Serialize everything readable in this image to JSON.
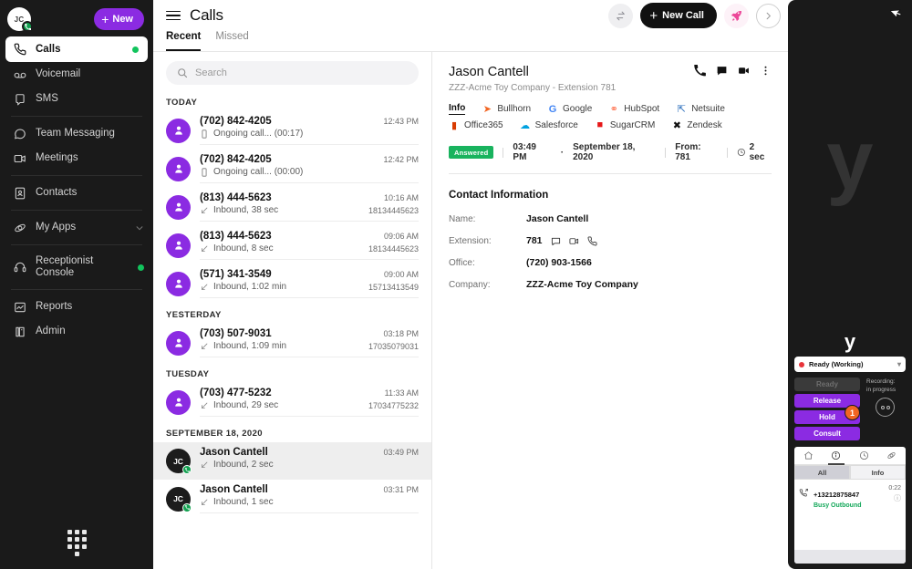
{
  "nav": {
    "avatar_initials": "JC",
    "new_button": "New",
    "items": [
      {
        "label": "Calls",
        "icon": "phone-icon",
        "active": true,
        "dot": true
      },
      {
        "label": "Voicemail",
        "icon": "voicemail-icon",
        "active": false,
        "dot": false
      },
      {
        "label": "SMS",
        "icon": "sms-icon",
        "active": false,
        "dot": false
      },
      {
        "label": "Team Messaging",
        "icon": "chat-icon",
        "active": false,
        "dot": false
      },
      {
        "label": "Meetings",
        "icon": "video-icon",
        "active": false,
        "dot": false
      },
      {
        "label": "Contacts",
        "icon": "contacts-icon",
        "active": false,
        "dot": false
      },
      {
        "label": "My Apps",
        "icon": "apps-icon",
        "active": false,
        "dot": false
      },
      {
        "label": "Receptionist Console",
        "icon": "headset-icon",
        "active": false,
        "dot": true
      },
      {
        "label": "Reports",
        "icon": "reports-icon",
        "active": false,
        "dot": false
      },
      {
        "label": "Admin",
        "icon": "admin-icon",
        "active": false,
        "dot": false
      }
    ]
  },
  "header": {
    "title": "Calls",
    "new_call_button": "New Call",
    "tabs": [
      {
        "label": "Recent",
        "active": true
      },
      {
        "label": "Missed",
        "active": false
      }
    ]
  },
  "search": {
    "placeholder": "Search",
    "value": ""
  },
  "calls": {
    "groups": [
      {
        "label": "TODAY",
        "rows": [
          {
            "avatar": "person",
            "initials": "",
            "name": "(702) 842-4205",
            "time": "12:43 PM",
            "detail": "Ongoing call... (00:17)",
            "number": "",
            "direction": "device",
            "selected": false
          },
          {
            "avatar": "person",
            "initials": "",
            "name": "(702) 842-4205",
            "time": "12:42 PM",
            "detail": "Ongoing call... (00:00)",
            "number": "",
            "direction": "device",
            "selected": false
          },
          {
            "avatar": "person",
            "initials": "",
            "name": "(813) 444-5623",
            "time": "10:16 AM",
            "detail": "Inbound, 38 sec",
            "number": "18134445623",
            "direction": "inbound",
            "selected": false
          },
          {
            "avatar": "person",
            "initials": "",
            "name": "(813) 444-5623",
            "time": "09:06 AM",
            "detail": "Inbound, 8 sec",
            "number": "18134445623",
            "direction": "inbound",
            "selected": false
          },
          {
            "avatar": "person",
            "initials": "",
            "name": "(571) 341-3549",
            "time": "09:00 AM",
            "detail": "Inbound, 1:02 min",
            "number": "15713413549",
            "direction": "inbound",
            "selected": false
          }
        ]
      },
      {
        "label": "YESTERDAY",
        "rows": [
          {
            "avatar": "person",
            "initials": "",
            "name": "(703) 507-9031",
            "time": "03:18 PM",
            "detail": "Inbound, 1:09 min",
            "number": "17035079031",
            "direction": "inbound",
            "selected": false
          }
        ]
      },
      {
        "label": "TUESDAY",
        "rows": [
          {
            "avatar": "person",
            "initials": "",
            "name": "(703) 477-5232",
            "time": "11:33 AM",
            "detail": "Inbound, 29 sec",
            "number": "17034775232",
            "direction": "inbound",
            "selected": false
          }
        ]
      },
      {
        "label": "SEPTEMBER 18, 2020",
        "rows": [
          {
            "avatar": "initials",
            "initials": "JC",
            "name": "Jason Cantell",
            "time": "03:49 PM",
            "detail": "Inbound, 2 sec",
            "number": "",
            "direction": "inbound",
            "selected": true
          },
          {
            "avatar": "initials",
            "initials": "JC",
            "name": "Jason Cantell",
            "time": "03:31 PM",
            "detail": "Inbound, 1 sec",
            "number": "",
            "direction": "inbound",
            "selected": false
          }
        ]
      }
    ]
  },
  "detail": {
    "name": "Jason Cantell",
    "subtitle": "ZZZ-Acme Toy Company - Extension 781",
    "crm_tabs": [
      {
        "label": "Info",
        "glyph": "",
        "active": true
      },
      {
        "label": "Bullhorn",
        "glyph": "📣",
        "active": false
      },
      {
        "label": "Google",
        "glyph": "G",
        "active": false
      },
      {
        "label": "HubSpot",
        "glyph": "Ⓗ",
        "active": false
      },
      {
        "label": "Netsuite",
        "glyph": "↱",
        "active": false
      },
      {
        "label": "Office365",
        "glyph": "◧",
        "active": false
      },
      {
        "label": "Salesforce",
        "glyph": "☁",
        "active": false
      },
      {
        "label": "SugarCRM",
        "glyph": "▮",
        "active": false
      },
      {
        "label": "Zendesk",
        "glyph": "✕",
        "active": false
      }
    ],
    "status_badge": "Answered",
    "call_time": "03:49 PM",
    "call_date": "September 18, 2020",
    "call_from": "From: 781",
    "call_duration": "2 sec",
    "section_title": "Contact Information",
    "fields": [
      {
        "label": "Name:",
        "value": "Jason Cantell",
        "has_icons": false
      },
      {
        "label": "Extension:",
        "value": "781",
        "has_icons": true
      },
      {
        "label": "Office:",
        "value": "(720) 903-1566",
        "has_icons": false
      },
      {
        "label": "Company:",
        "value": "ZZZ-Acme Toy Company",
        "has_icons": false
      }
    ]
  },
  "phone_widget": {
    "logo": "у",
    "status": "Ready (Working)",
    "status_color": "#e8343a",
    "buttons": [
      {
        "label": "Ready",
        "state": "disabled"
      },
      {
        "label": "Release",
        "state": "active"
      },
      {
        "label": "Hold",
        "state": "active"
      },
      {
        "label": "Consult",
        "state": "active"
      }
    ],
    "recording_label_1": "Recording:",
    "recording_label_2": "in progress",
    "queue_badge": "1",
    "segmented": [
      {
        "label": "All",
        "active": true
      },
      {
        "label": "Info",
        "active": false
      }
    ],
    "entries": [
      {
        "number": "+13212875847",
        "status": "Busy Outbound",
        "duration": "0:22"
      }
    ]
  },
  "colors": {
    "purple": "#8b2be2",
    "green": "#12a150",
    "orange": "#f26522",
    "dark": "#1a1a1a"
  }
}
